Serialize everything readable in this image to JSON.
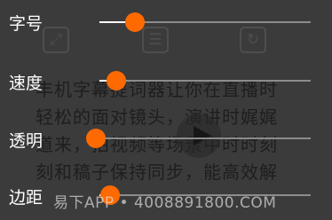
{
  "background": {
    "lines": [
      "丰机字幕提词器让你在直播时",
      "轻松的面对镜头，演讲时娓娓",
      "道来，拍视频等场景中时时刻",
      "刻和稿子保持同步，能高效解"
    ],
    "icons": [
      "expand-icon",
      "list-icon",
      "refresh-icon"
    ]
  },
  "sliders": [
    {
      "label": "字号",
      "value": 0.17
    },
    {
      "label": "速度",
      "value": 0.08
    },
    {
      "label": "透明",
      "value": 0.0
    },
    {
      "label": "边距",
      "value": 0.05
    }
  ],
  "watermark": "易下APP • 4008891800.COM",
  "accent_color": "#ff6a00"
}
